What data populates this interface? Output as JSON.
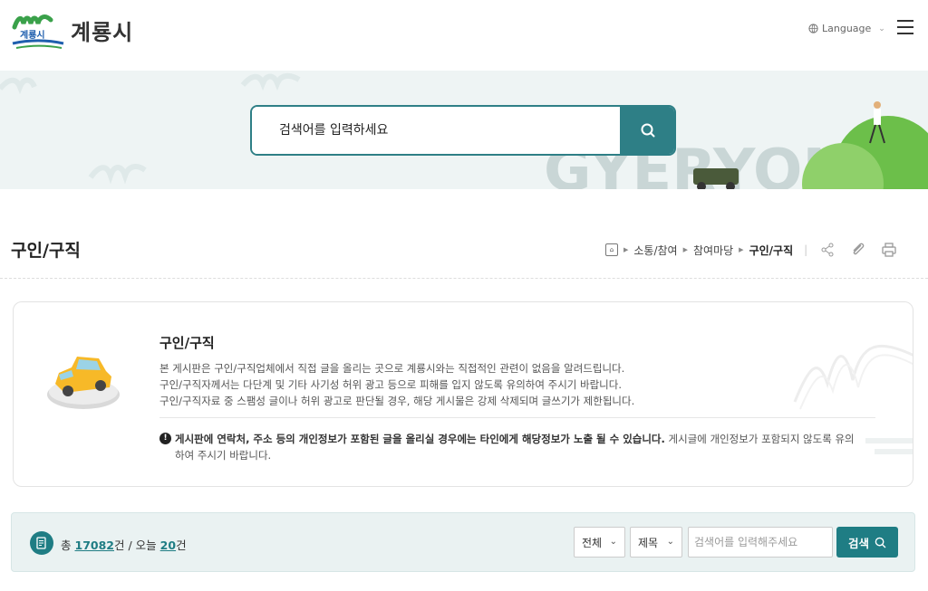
{
  "header": {
    "logo_caption": "계룡시",
    "logo_text": "계룡시",
    "language_label": "Language"
  },
  "hero": {
    "search_placeholder": "검색어를 입력하세요",
    "brand_word": "GYERYONG"
  },
  "page": {
    "title": "구인/구직",
    "breadcrumb": [
      "소통/참여",
      "참여마당",
      "구인/구직"
    ]
  },
  "info": {
    "title": "구인/구직",
    "lines": [
      "본 게시판은 구인/구직업체에서 직접 글을 올리는 곳으로 계룡시와는 직접적인 관련이 없음을 알려드립니다.",
      "구인/구직자께서는 다단계 및 기타 사기성 허위 광고 등으로 피해를 입지 않도록 유의하여 주시기 바랍니다.",
      "구인/구직자료 중 스팸성 글이나 허위 광고로 판단될 경우, 해당 게시물은 강제 삭제되며 글쓰기가 제한됩니다."
    ],
    "warning_bold": "게시판에 연락처, 주소 등의 개인정보가 포함된 글을 올리실 경우에는 타인에게 해당정보가 노출 될 수 있습니다.",
    "warning_rest": " 게시글에 개인정보가 포함되지 않도록 유의하여 주시기 바랍니다."
  },
  "board": {
    "total_label": "총",
    "total_count": "17082",
    "unit": "건",
    "today_label": "/ 오늘",
    "today_count": "20",
    "filter_scope": "전체",
    "filter_field": "제목",
    "keyword_placeholder": "검색어를 입력해주세요",
    "search_button": "검색"
  },
  "colors": {
    "brand_teal": "#2e7f86",
    "logo_green": "#3aa14a",
    "logo_blue": "#1f5fae"
  },
  "icons": [
    "globe-icon",
    "hamburger-menu-icon",
    "search-icon",
    "home-icon",
    "share-icon",
    "attach-icon",
    "print-icon",
    "warning-icon",
    "document-icon"
  ]
}
